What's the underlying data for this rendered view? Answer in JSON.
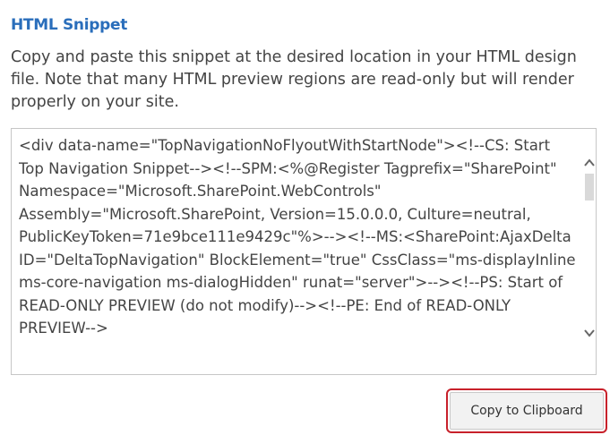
{
  "section": {
    "heading": "HTML Snippet",
    "description": "Copy and paste this snippet at the desired location in your HTML design file. Note that many HTML preview regions are read-only but will render properly on your site."
  },
  "snippet": {
    "code": "<div data-name=\"TopNavigationNoFlyoutWithStartNode\"><!--CS: Start Top Navigation Snippet--><!--SPM:<%@Register Tagprefix=\"SharePoint\" Namespace=\"Microsoft.SharePoint.WebControls\" Assembly=\"Microsoft.SharePoint, Version=15.0.0.0, Culture=neutral, PublicKeyToken=71e9bce111e9429c\"%>--><!--MS:<SharePoint:AjaxDelta ID=\"DeltaTopNavigation\" BlockElement=\"true\" CssClass=\"ms-displayInline ms-core-navigation ms-dialogHidden\" runat=\"server\">--><!--PS: Start of READ-ONLY PREVIEW (do not modify)--><!--PE: End of READ-ONLY PREVIEW-->"
  },
  "actions": {
    "copy_label": "Copy to Clipboard"
  },
  "icons": {
    "scroll_up": "chevron-up-icon",
    "scroll_down": "chevron-down-icon"
  },
  "colors": {
    "heading": "#2a6ebb",
    "highlight_border": "#c8212b"
  }
}
